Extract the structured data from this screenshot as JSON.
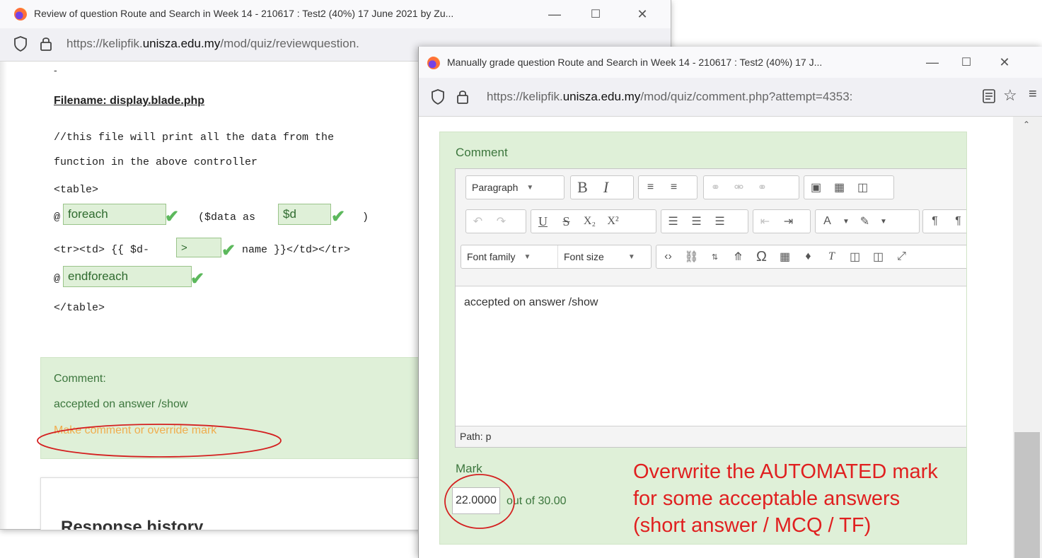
{
  "window1": {
    "title": "Review of question Route and Search in Week 14 - 210617 : Test2 (40%) 17 June 2021 by Zu...",
    "url_prefix": "https://kelipfik.",
    "url_domain": "unisza.edu.my",
    "url_path": "/mod/quiz/reviewquestion.",
    "dash": "-",
    "filename_heading": "Filename: display.blade.php",
    "code": {
      "line1": "//this file will print all the data from the",
      "line2": "function in the above controller",
      "line3": "<table>",
      "at1": "@",
      "answer_foreach": "foreach",
      "data_as": "($data as",
      "answer_d": "$d",
      "close_paren": ")",
      "tr_start": "<tr><td> {{ $d-",
      "answer_arrow": ">",
      "tr_end": "name }}</td></tr>",
      "at2": "@",
      "answer_endforeach": "endforeach",
      "table_end": "</table>"
    },
    "comment_label": "Comment:",
    "comment_text": "accepted on answer /show",
    "override_link": "Make comment or override mark",
    "response_history": "Response history"
  },
  "window2": {
    "title": "Manually grade question Route and Search in Week 14 - 210617 : Test2 (40%) 17 J...",
    "url_prefix": "https://kelipfik.",
    "url_domain": "unisza.edu.my",
    "url_path": "/mod/quiz/comment.php?attempt=4353:",
    "comment_heading": "Comment",
    "toolbar": {
      "paragraph": "Paragraph",
      "font_family": "Font family",
      "font_size": "Font size"
    },
    "editor_text": "accepted on answer /show",
    "path_label": "Path: p",
    "mark_label": "Mark",
    "mark_value": "22.0000",
    "out_of": "out of 30.00"
  },
  "annotation": {
    "line1": "Overwrite the AUTOMATED mark",
    "line2": "for some acceptable answers",
    "line3": "(short answer / MCQ / TF)",
    "color": "#e02020"
  },
  "icons": [
    "firefox-icon",
    "shield-icon",
    "lock-icon",
    "reader-view-icon",
    "star-icon",
    "hamburger-menu-icon",
    "check-icon"
  ]
}
